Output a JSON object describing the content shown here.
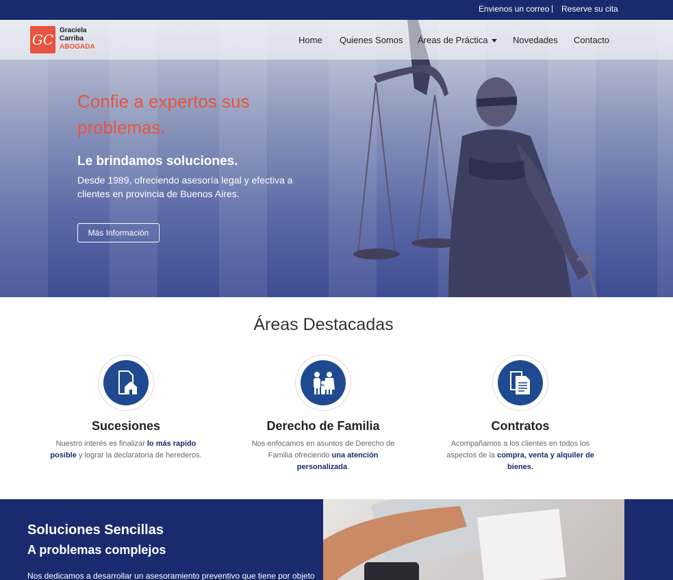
{
  "topbar": {
    "email_link": "Envienos un correo",
    "separator": "|",
    "appointment_link": "Reserve su cita"
  },
  "logo": {
    "monogram": "GC",
    "line1": "Graciela",
    "line2": "Carriba",
    "line3": "ABOGADA"
  },
  "nav": {
    "home": "Home",
    "about": "Quienes Somos",
    "practice": "Áreas de Práctica",
    "news": "Novedades",
    "contact": "Contacto"
  },
  "hero": {
    "title": "Confie a expertos sus problemas.",
    "subtitle": "Le brindamos soluciones.",
    "description": "Desde 1989, ofreciendo asesoría legal y efectiva a clientes en provincia de Buenos Aires.",
    "button": "Más Información"
  },
  "areas": {
    "title": "Áreas Destacadas",
    "items": [
      {
        "title": "Sucesiones",
        "pre": "Nuestro interés es finalizar ",
        "bold": "lo más rapido posible",
        "post": " y lograr la declaratoria de herederos.",
        "icon": "house-document-icon"
      },
      {
        "title": "Derecho de Familia",
        "pre": "Nos enfocamos en asuntos de Derecho de Familia ofreciendo ",
        "bold": "una atención personalizada",
        "post": ".",
        "icon": "family-icon"
      },
      {
        "title": "Contratos",
        "pre": "Acompañamos a los clientes en todos los aspectos de la ",
        "bold": "compra, venta y alquiler de bienes.",
        "post": "",
        "icon": "documents-icon"
      }
    ]
  },
  "solutions": {
    "title": "Soluciones Sencillas",
    "subtitle": "A problemas complejos",
    "text": "Nos dedicamos a desarrollar un asesoramiento preventivo que tiene por objeto"
  },
  "colors": {
    "navy": "#1a2a6e",
    "accent": "#e8543f",
    "icon_blue": "#1f4a8f"
  }
}
